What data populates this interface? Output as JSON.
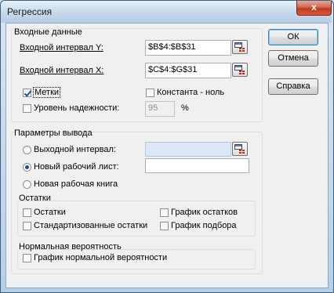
{
  "window": {
    "title": "Регрессия",
    "close_glyph": "x"
  },
  "input_group": {
    "title": "Входные данные",
    "range_y": {
      "label": "Входной интервал Y:",
      "value": "$B$4:$B$31"
    },
    "range_x": {
      "label": "Входной интервал X:",
      "value": "$C$4:$G$31"
    },
    "labels": {
      "label": "Метки",
      "checked": true
    },
    "constant_zero": {
      "label": "Константа - ноль",
      "checked": false
    },
    "confidence": {
      "label": "Уровень надежности:",
      "checked": false,
      "value": "95",
      "unit": "%"
    }
  },
  "output_group": {
    "title": "Параметры вывода",
    "output_range": {
      "label": "Выходной интервал:",
      "selected": false,
      "value": ""
    },
    "new_sheet": {
      "label": "Новый рабочий лист:",
      "selected": true,
      "value": ""
    },
    "new_workbook": {
      "label": "Новая рабочая книга",
      "selected": false
    }
  },
  "residuals_group": {
    "title": "Остатки",
    "residuals": {
      "label": "Остатки",
      "checked": false
    },
    "standardized": {
      "label": "Стандартизованные остатки",
      "checked": false
    },
    "residual_plot": {
      "label": "График остатков",
      "checked": false
    },
    "fit_plot": {
      "label": "График подбора",
      "checked": false
    }
  },
  "normal_group": {
    "title": "Нормальная вероятность",
    "normal_plot": {
      "label": "График нормальной вероятности",
      "checked": false
    }
  },
  "buttons": {
    "ok": "ОК",
    "cancel": "Отмена",
    "help": "Справка"
  },
  "icons": {
    "close": "close-icon",
    "ref": "collapse-dialog-icon"
  }
}
